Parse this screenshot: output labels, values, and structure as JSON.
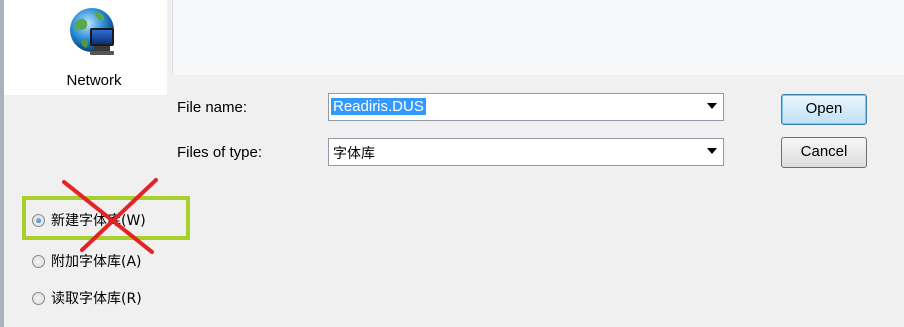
{
  "places": {
    "network_label": "Network"
  },
  "form": {
    "file_name_label": "File name:",
    "file_name_value": "Readiris.DUS",
    "files_of_type_label": "Files of type:",
    "files_of_type_value": "字体库"
  },
  "buttons": {
    "open_label": "Open",
    "cancel_label": "Cancel"
  },
  "options": [
    {
      "label": "新建字体库(W)",
      "checked": true
    },
    {
      "label": "附加字体库(A)",
      "checked": false
    },
    {
      "label": "读取字体库(R)",
      "checked": false
    }
  ],
  "colors": {
    "highlight": "#a8d02a",
    "cross": "#e32424",
    "selection": "#3399ff"
  },
  "icons": {
    "network": "network-globe-icon"
  }
}
